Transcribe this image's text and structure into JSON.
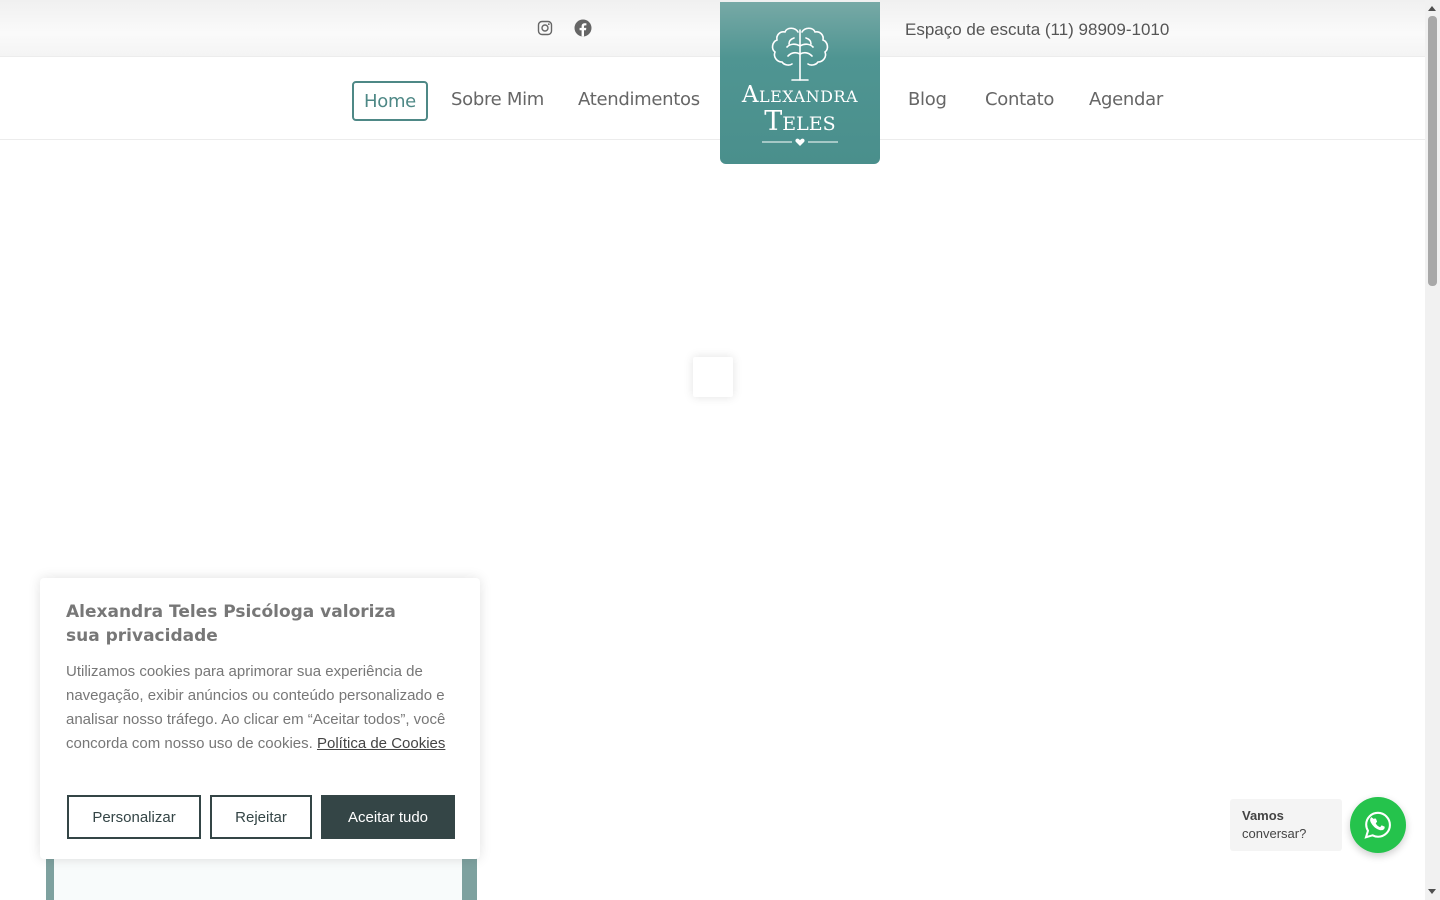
{
  "topbar": {
    "phone_text": "Espaço de escuta (11) 98909-1010",
    "social": [
      {
        "name": "instagram-icon"
      },
      {
        "name": "facebook-icon"
      }
    ]
  },
  "nav": {
    "items": [
      {
        "label": "Home",
        "active": true
      },
      {
        "label": "Sobre Mim"
      },
      {
        "label": "Atendimentos"
      },
      {
        "label": "Blog"
      },
      {
        "label": "Contato"
      },
      {
        "label": "Agendar"
      }
    ]
  },
  "logo": {
    "line1": "Alexandra",
    "line2": "Teles"
  },
  "cookie": {
    "title": "Alexandra Teles Psicóloga valoriza sua privacidade",
    "text": "Utilizamos cookies para aprimorar sua experiência de navegação, exibir anúncios ou conteúdo personalizado e analisar nosso tráfego. Ao clicar em “Aceitar todos”, você concorda com nosso uso de cookies.",
    "link": "Política de Cookies",
    "buttons": {
      "customize": "Personalizar",
      "reject": "Rejeitar",
      "accept": "Aceitar tudo"
    }
  },
  "whatsapp": {
    "line1": "Vamos",
    "line2": "conversar?"
  },
  "colors": {
    "brand_teal": "#4e8886",
    "dark_button": "#344546",
    "whatsapp_green": "#25c34c"
  }
}
